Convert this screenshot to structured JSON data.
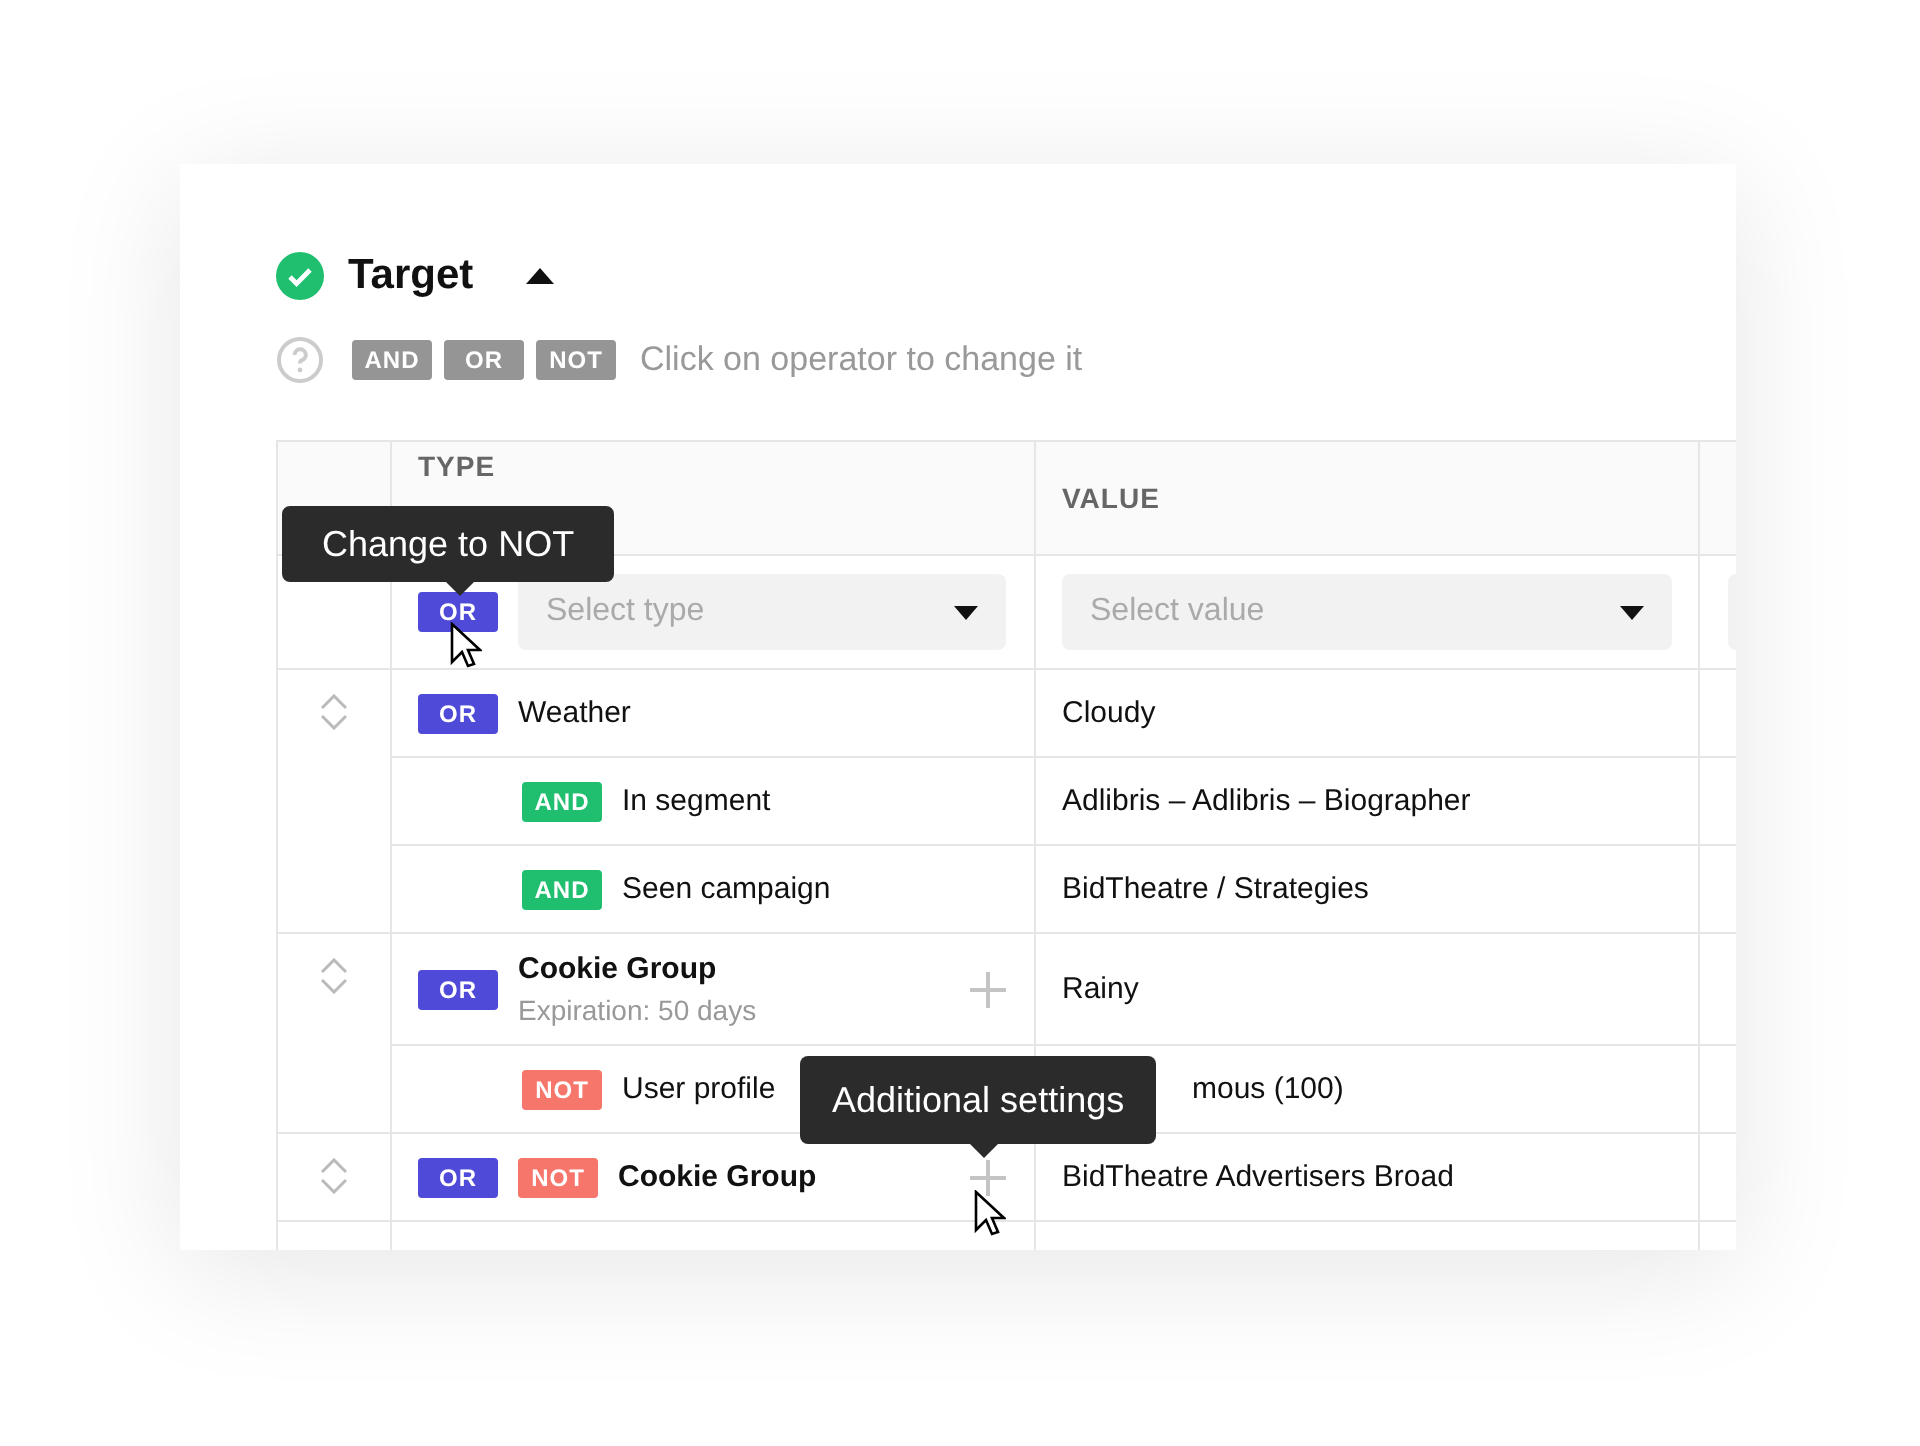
{
  "section": {
    "title": "Target",
    "expanded": true,
    "valid": true
  },
  "legend": {
    "operators": [
      {
        "label": "AND"
      },
      {
        "label": "OR"
      },
      {
        "label": "NOT"
      }
    ],
    "hint": "Click on operator to change it"
  },
  "table": {
    "columns": [
      "TYPE",
      "VALUE"
    ],
    "filter": {
      "operator": {
        "kind": "or",
        "label": "OR"
      },
      "type_placeholder": "Select type",
      "value_placeholder": "Select value"
    },
    "groups": [
      {
        "rows": [
          {
            "nested": false,
            "operators": [
              {
                "kind": "or",
                "label": "OR"
              }
            ],
            "label": "Weather",
            "bold": false,
            "value": "Cloudy",
            "add": false,
            "covered": false
          },
          {
            "nested": true,
            "operators": [
              {
                "kind": "and",
                "label": "AND"
              }
            ],
            "label": "In segment",
            "bold": false,
            "value": "Adlibris – Adlibris – Biographer",
            "add": false,
            "covered": false
          },
          {
            "nested": true,
            "operators": [
              {
                "kind": "and",
                "label": "AND"
              }
            ],
            "label": "Seen campaign",
            "bold": false,
            "value": "BidTheatre / Strategies",
            "add": false,
            "covered": false
          }
        ]
      },
      {
        "rows": [
          {
            "nested": false,
            "operators": [
              {
                "kind": "or",
                "label": "OR"
              }
            ],
            "label": "Cookie Group",
            "sublabel": "Expiration: 50 days",
            "bold": true,
            "value": "Rainy",
            "add": true,
            "covered": false
          },
          {
            "nested": true,
            "operators": [
              {
                "kind": "not",
                "label": "NOT"
              }
            ],
            "label": "User profile",
            "bold": false,
            "value": "mous (100)",
            "add": false,
            "covered": true
          }
        ]
      },
      {
        "rows": [
          {
            "nested": false,
            "operators": [
              {
                "kind": "or",
                "label": "OR"
              },
              {
                "kind": "not",
                "label": "NOT"
              }
            ],
            "label": "Cookie Group",
            "bold": true,
            "value": "BidTheatre Advertisers Broad",
            "add": true,
            "covered": false
          }
        ]
      }
    ]
  },
  "tooltips": [
    {
      "text": "Change to NOT"
    },
    {
      "text": "Additional settings"
    }
  ]
}
